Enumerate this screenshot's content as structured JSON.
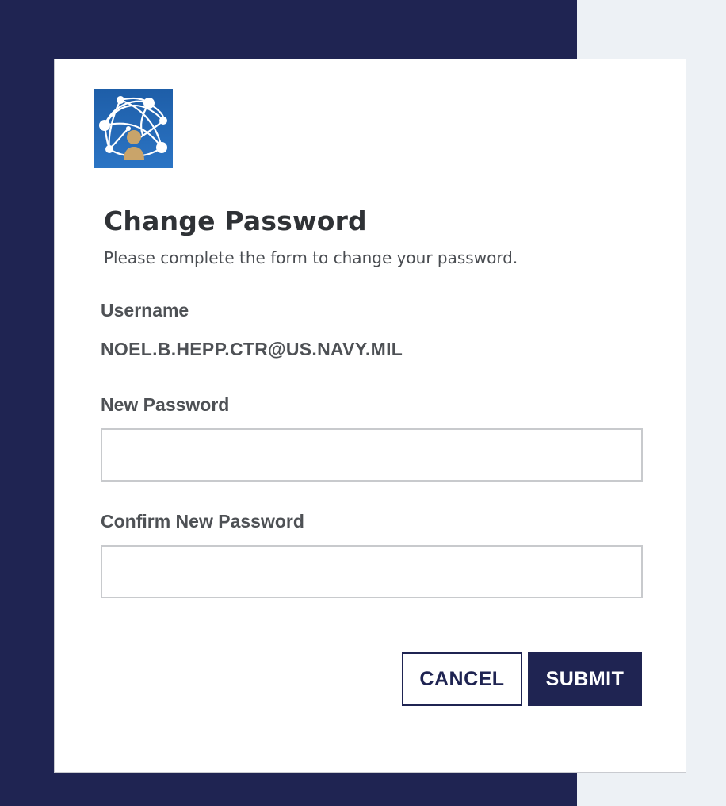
{
  "colors": {
    "navy": "#1f2452",
    "background_right": "#edf1f5",
    "card": "#ffffff",
    "logo_blue": "#2b74c4",
    "logo_person": "#c9a46a"
  },
  "logo": {
    "icon": "network-globe-person-icon"
  },
  "form": {
    "title": "Change Password",
    "subtitle": "Please complete the form to change your password.",
    "username_label": "Username",
    "username_value": "NOEL.B.HEPP.CTR@US.NAVY.MIL",
    "new_password_label": "New Password",
    "new_password_value": "",
    "confirm_password_label": "Confirm New Password",
    "confirm_password_value": ""
  },
  "actions": {
    "cancel_label": "CANCEL",
    "submit_label": "SUBMIT"
  }
}
